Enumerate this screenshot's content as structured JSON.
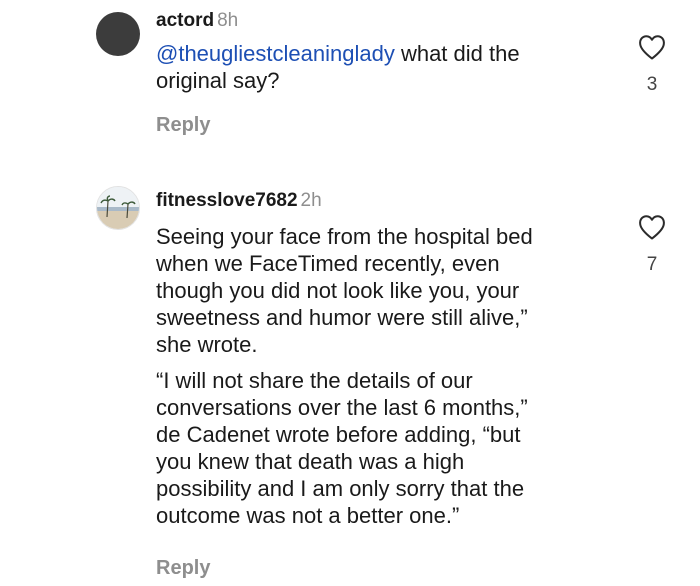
{
  "comments": [
    {
      "username": "actord",
      "time": "8h",
      "mention": "@theugliestcleaninglady",
      "text": " what did the\noriginal say?",
      "reply_label": "Reply",
      "likes": "3",
      "avatar_icon": "default-avatar-icon",
      "avatar_color": "#3c3c3c"
    },
    {
      "username": "fitnesslove7682",
      "time": "2h",
      "paragraphs": [
        "Seeing your face from the hospital bed\nwhen we FaceTimed recently, even\nthough you did not look like you, your\nsweetness and humor were still alive,”\nshe wrote.",
        "“I will not share the details of our\nconversations over the last 6 months,”\nde Cadenet wrote before adding, “but\nyou knew that death was a high\npossibility and I am only sorry that the\noutcome was not a better one.”"
      ],
      "reply_label": "Reply",
      "likes": "7",
      "avatar_icon": "beach-photo-avatar-icon"
    }
  ],
  "icons": {
    "like": "heart-outline-icon"
  },
  "colors": {
    "mention": "#1d4fb4",
    "secondary_text": "#8e8e8e",
    "primary_text": "#1a1a1a"
  }
}
